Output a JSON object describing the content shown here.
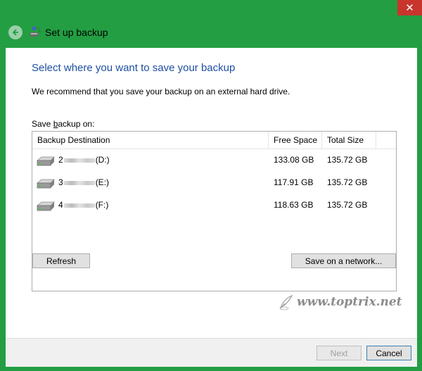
{
  "window": {
    "title": "Set up backup",
    "close_glyph": "✕",
    "accent": "#239e43"
  },
  "page": {
    "heading": "Select where you want to save your backup",
    "recommend": "We recommend that you save your backup on an external hard drive.",
    "save_label_pre": "Save ",
    "save_label_mnemonic": "b",
    "save_label_post": "ackup on:"
  },
  "table": {
    "headers": [
      "Backup Destination",
      "Free Space",
      "Total Size"
    ],
    "rows": [
      {
        "prefix": "2",
        "drive": "(D:)",
        "free": "133.08 GB",
        "total": "135.72 GB",
        "icon": "hard-drive-icon"
      },
      {
        "prefix": "3",
        "drive": "(E:)",
        "free": "117.91 GB",
        "total": "135.72 GB",
        "icon": "hard-drive-icon"
      },
      {
        "prefix": "4",
        "drive": "(F:)",
        "free": "118.63 GB",
        "total": "135.72 GB",
        "icon": "hard-drive-icon"
      }
    ]
  },
  "buttons": {
    "refresh": "Refresh",
    "network": "Save on a network...",
    "next": "Next",
    "cancel": "Cancel"
  },
  "watermark": {
    "text": "www.toptrix.net"
  }
}
